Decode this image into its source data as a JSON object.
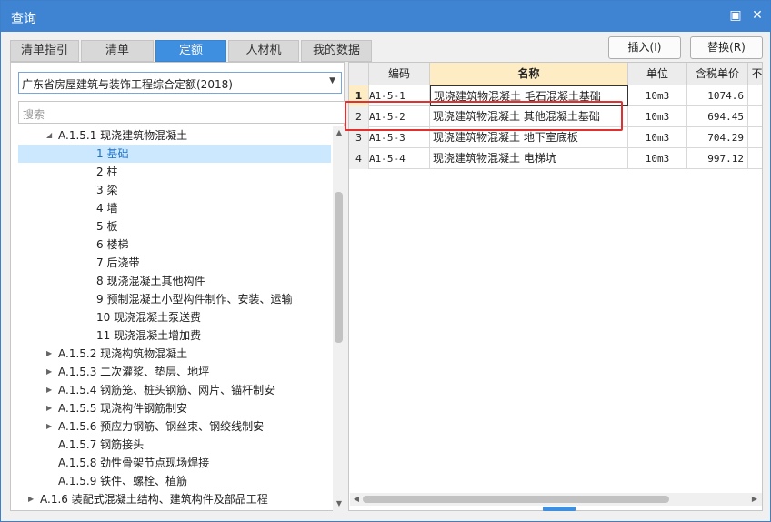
{
  "window": {
    "title": "查询"
  },
  "titlebar": {
    "restore_glyph": "▣",
    "close_glyph": "✕"
  },
  "tabs": [
    {
      "label": "清单指引",
      "active": false
    },
    {
      "label": "清单",
      "active": false
    },
    {
      "label": "定额",
      "active": true
    },
    {
      "label": "人材机",
      "active": false
    },
    {
      "label": "我的数据",
      "active": false
    }
  ],
  "actions": {
    "insert_label": "插入(I)",
    "replace_label": "替换(R)"
  },
  "library_select": {
    "value": "广东省房屋建筑与装饰工程综合定额(2018)"
  },
  "search": {
    "placeholder": "搜索"
  },
  "tree": [
    {
      "label": "A.1.5.1 现浇建筑物混凝土",
      "toggle": "◢",
      "level": 1,
      "selected": false
    },
    {
      "label": "1 基础",
      "toggle": "",
      "level": 2,
      "selected": true
    },
    {
      "label": "2 柱",
      "toggle": "",
      "level": 2,
      "selected": false
    },
    {
      "label": "3 梁",
      "toggle": "",
      "level": 2,
      "selected": false
    },
    {
      "label": "4 墙",
      "toggle": "",
      "level": 2,
      "selected": false
    },
    {
      "label": "5 板",
      "toggle": "",
      "level": 2,
      "selected": false
    },
    {
      "label": "6 楼梯",
      "toggle": "",
      "level": 2,
      "selected": false
    },
    {
      "label": "7 后浇带",
      "toggle": "",
      "level": 2,
      "selected": false
    },
    {
      "label": "8 现浇混凝土其他构件",
      "toggle": "",
      "level": 2,
      "selected": false
    },
    {
      "label": "9 预制混凝土小型构件制作、安装、运输",
      "toggle": "",
      "level": 2,
      "selected": false
    },
    {
      "label": "10 现浇混凝土泵送费",
      "toggle": "",
      "level": 2,
      "selected": false
    },
    {
      "label": "11 现浇混凝土增加费",
      "toggle": "",
      "level": 2,
      "selected": false
    },
    {
      "label": "A.1.5.2 现浇构筑物混凝土",
      "toggle": "▶",
      "level": 1,
      "selected": false
    },
    {
      "label": "A.1.5.3 二次灌浆、垫层、地坪",
      "toggle": "▶",
      "level": 1,
      "selected": false
    },
    {
      "label": "A.1.5.4 钢筋笼、桩头钢筋、网片、锚杆制安",
      "toggle": "▶",
      "level": 1,
      "selected": false
    },
    {
      "label": "A.1.5.5 现浇构件钢筋制安",
      "toggle": "▶",
      "level": 1,
      "selected": false
    },
    {
      "label": "A.1.5.6 预应力钢筋、钢丝束、钢绞线制安",
      "toggle": "▶",
      "level": 1,
      "selected": false
    },
    {
      "label": "A.1.5.7 钢筋接头",
      "toggle": "",
      "level": 1,
      "selected": false
    },
    {
      "label": "A.1.5.8 劲性骨架节点现场焊接",
      "toggle": "",
      "level": 1,
      "selected": false
    },
    {
      "label": "A.1.5.9 铁件、螺栓、植筋",
      "toggle": "",
      "level": 1,
      "selected": false
    },
    {
      "label": "A.1.6 装配式混凝土结构、建筑构件及部品工程",
      "toggle": "▶",
      "level": 0,
      "selected": false
    }
  ],
  "grid": {
    "columns": {
      "code": "编码",
      "name": "名称",
      "unit": "单位",
      "price": "含税单价",
      "more": "不"
    },
    "rows": [
      {
        "idx": "1",
        "code": "A1-5-1",
        "name": "现浇建筑物混凝土 毛石混凝土基础",
        "unit": "10m3",
        "price": "1074.6",
        "current": true
      },
      {
        "idx": "2",
        "code": "A1-5-2",
        "name": "现浇建筑物混凝土 其他混凝土基础",
        "unit": "10m3",
        "price": "694.45",
        "current": false
      },
      {
        "idx": "3",
        "code": "A1-5-3",
        "name": "现浇建筑物混凝土 地下室底板",
        "unit": "10m3",
        "price": "704.29",
        "current": false
      },
      {
        "idx": "4",
        "code": "A1-5-4",
        "name": "现浇建筑物混凝土 电梯坑",
        "unit": "10m3",
        "price": "997.12",
        "current": false
      }
    ]
  },
  "scroll_glyphs": {
    "up": "▲",
    "down": "▼",
    "left": "◀",
    "right": "▶"
  },
  "colors": {
    "accent": "#3f84d2",
    "highlight": "#e03030",
    "selection": "#cce8ff"
  }
}
